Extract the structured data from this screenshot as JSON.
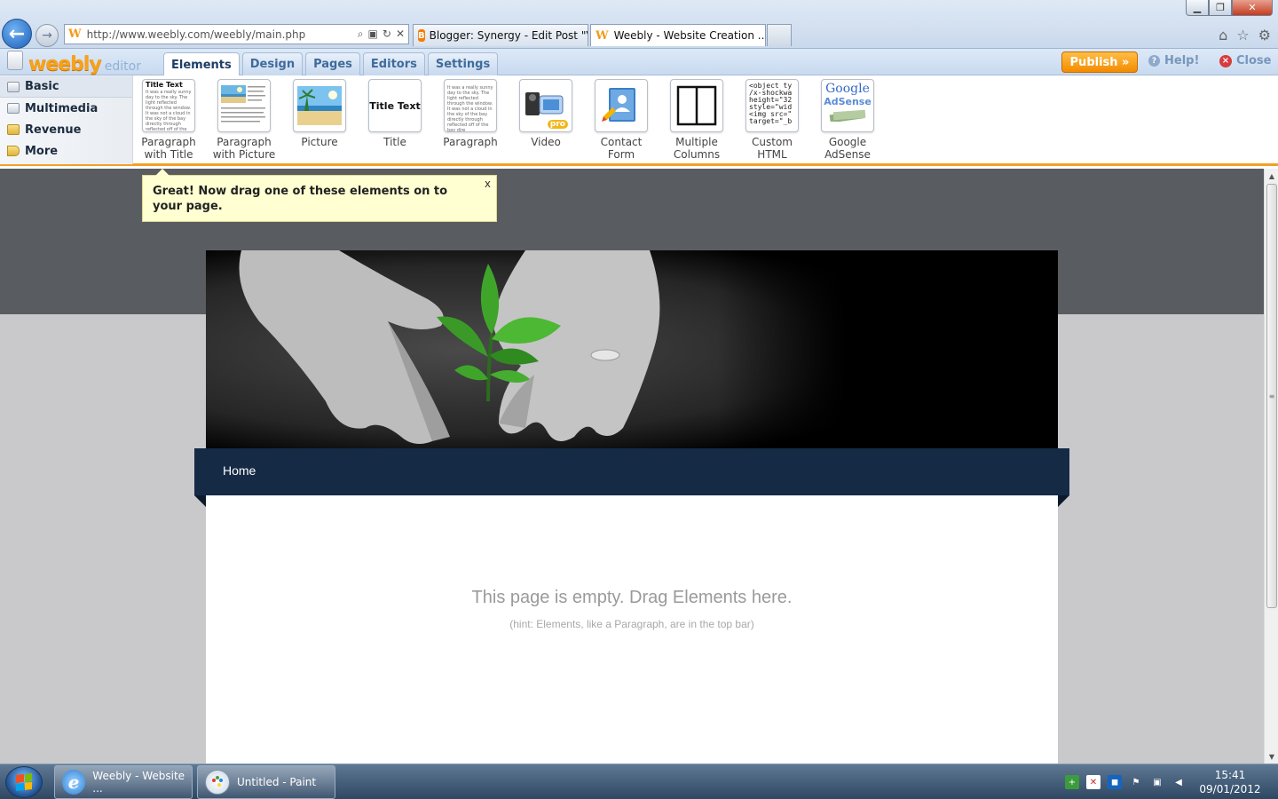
{
  "browser": {
    "window_buttons": {
      "minimize": "▁",
      "maximize": "❐",
      "close": "✕"
    },
    "address_url": "http://www.weebly.com/weebly/main.php",
    "tabs": [
      {
        "title": "Blogger: Synergy - Edit Post \"V..."
      },
      {
        "title": "Weebly - Website Creation ...",
        "close": "✕"
      }
    ]
  },
  "editor": {
    "logo": "weebly",
    "logo_sub": "editor",
    "tabs": [
      "Elements",
      "Design",
      "Pages",
      "Editors",
      "Settings"
    ],
    "active_tab": "Elements",
    "publish_label": "Publish »",
    "help_label": "Help!",
    "close_label": "Close"
  },
  "categories": [
    "Basic",
    "Multimedia",
    "Revenue",
    "More"
  ],
  "elements": [
    {
      "label1": "Paragraph",
      "label2": "with Title",
      "icon": "paragraph-with-title-icon"
    },
    {
      "label1": "Paragraph",
      "label2": "with Picture",
      "icon": "paragraph-with-picture-icon"
    },
    {
      "label1": "Picture",
      "label2": "",
      "icon": "picture-icon"
    },
    {
      "label1": "Title",
      "label2": "",
      "icon": "title-icon"
    },
    {
      "label1": "Paragraph",
      "label2": "",
      "icon": "paragraph-icon"
    },
    {
      "label1": "Video",
      "label2": "",
      "icon": "video-icon"
    },
    {
      "label1": "Contact",
      "label2": "Form",
      "icon": "contact-form-icon"
    },
    {
      "label1": "Multiple",
      "label2": "Columns",
      "icon": "multiple-columns-icon"
    },
    {
      "label1": "Custom",
      "label2": "HTML",
      "icon": "custom-html-icon"
    },
    {
      "label1": "Google",
      "label2": "AdSense",
      "icon": "google-adsense-icon"
    }
  ],
  "icon_text": {
    "title_text": "Title Text",
    "mini_paragraph": "It was a really sunny day to the sky. The light reflected through the window. It was not a cloud in the sky of the bay directly through reflected off of the bay dire",
    "html_code": "<object ty /x-shockwa height=\"32 style=\"wid <img src=\" target=\"_b",
    "google": "Google",
    "adsense": "AdSense",
    "pro": "pro"
  },
  "tip": {
    "text": "Great! Now drag one of these elements on to your page.",
    "close": "x"
  },
  "site": {
    "nav_home": "Home",
    "empty_message": "This page is empty. Drag Elements here.",
    "empty_hint": "(hint: Elements, like a Paragraph, are in the top bar)"
  },
  "taskbar": {
    "items": [
      "Weebly - Website ...",
      "Untitled - Paint"
    ],
    "time": "15:41",
    "date": "09/01/2012"
  },
  "colors": {
    "accent_orange": "#f2a024",
    "nav_bar": "#152a45",
    "canvas_band": "#595c60"
  }
}
